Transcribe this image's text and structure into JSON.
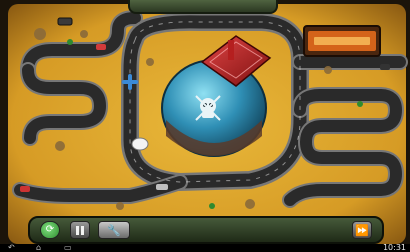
{
  "hud": {
    "buttons": [
      {
        "name": "speed-button",
        "icon": "green-arrows-icon"
      },
      {
        "name": "pause-button",
        "icon": "pause-icon"
      },
      {
        "name": "tool-button",
        "icon": "tool-icon"
      },
      {
        "name": "fast-forward-button",
        "icon": "fast-forward-icon"
      }
    ]
  },
  "system_bar": {
    "clock": "10:31",
    "nav_icons": [
      "back-icon",
      "home-icon",
      "recent-apps-icon"
    ]
  },
  "colors": {
    "sand": "#d9a52a",
    "road": "#2b2b2b",
    "road_edge": "#7a7a7a",
    "hud_green": "#465a3a",
    "dome_blue": "#3aa7c9",
    "tower_red": "#c72a2a"
  }
}
